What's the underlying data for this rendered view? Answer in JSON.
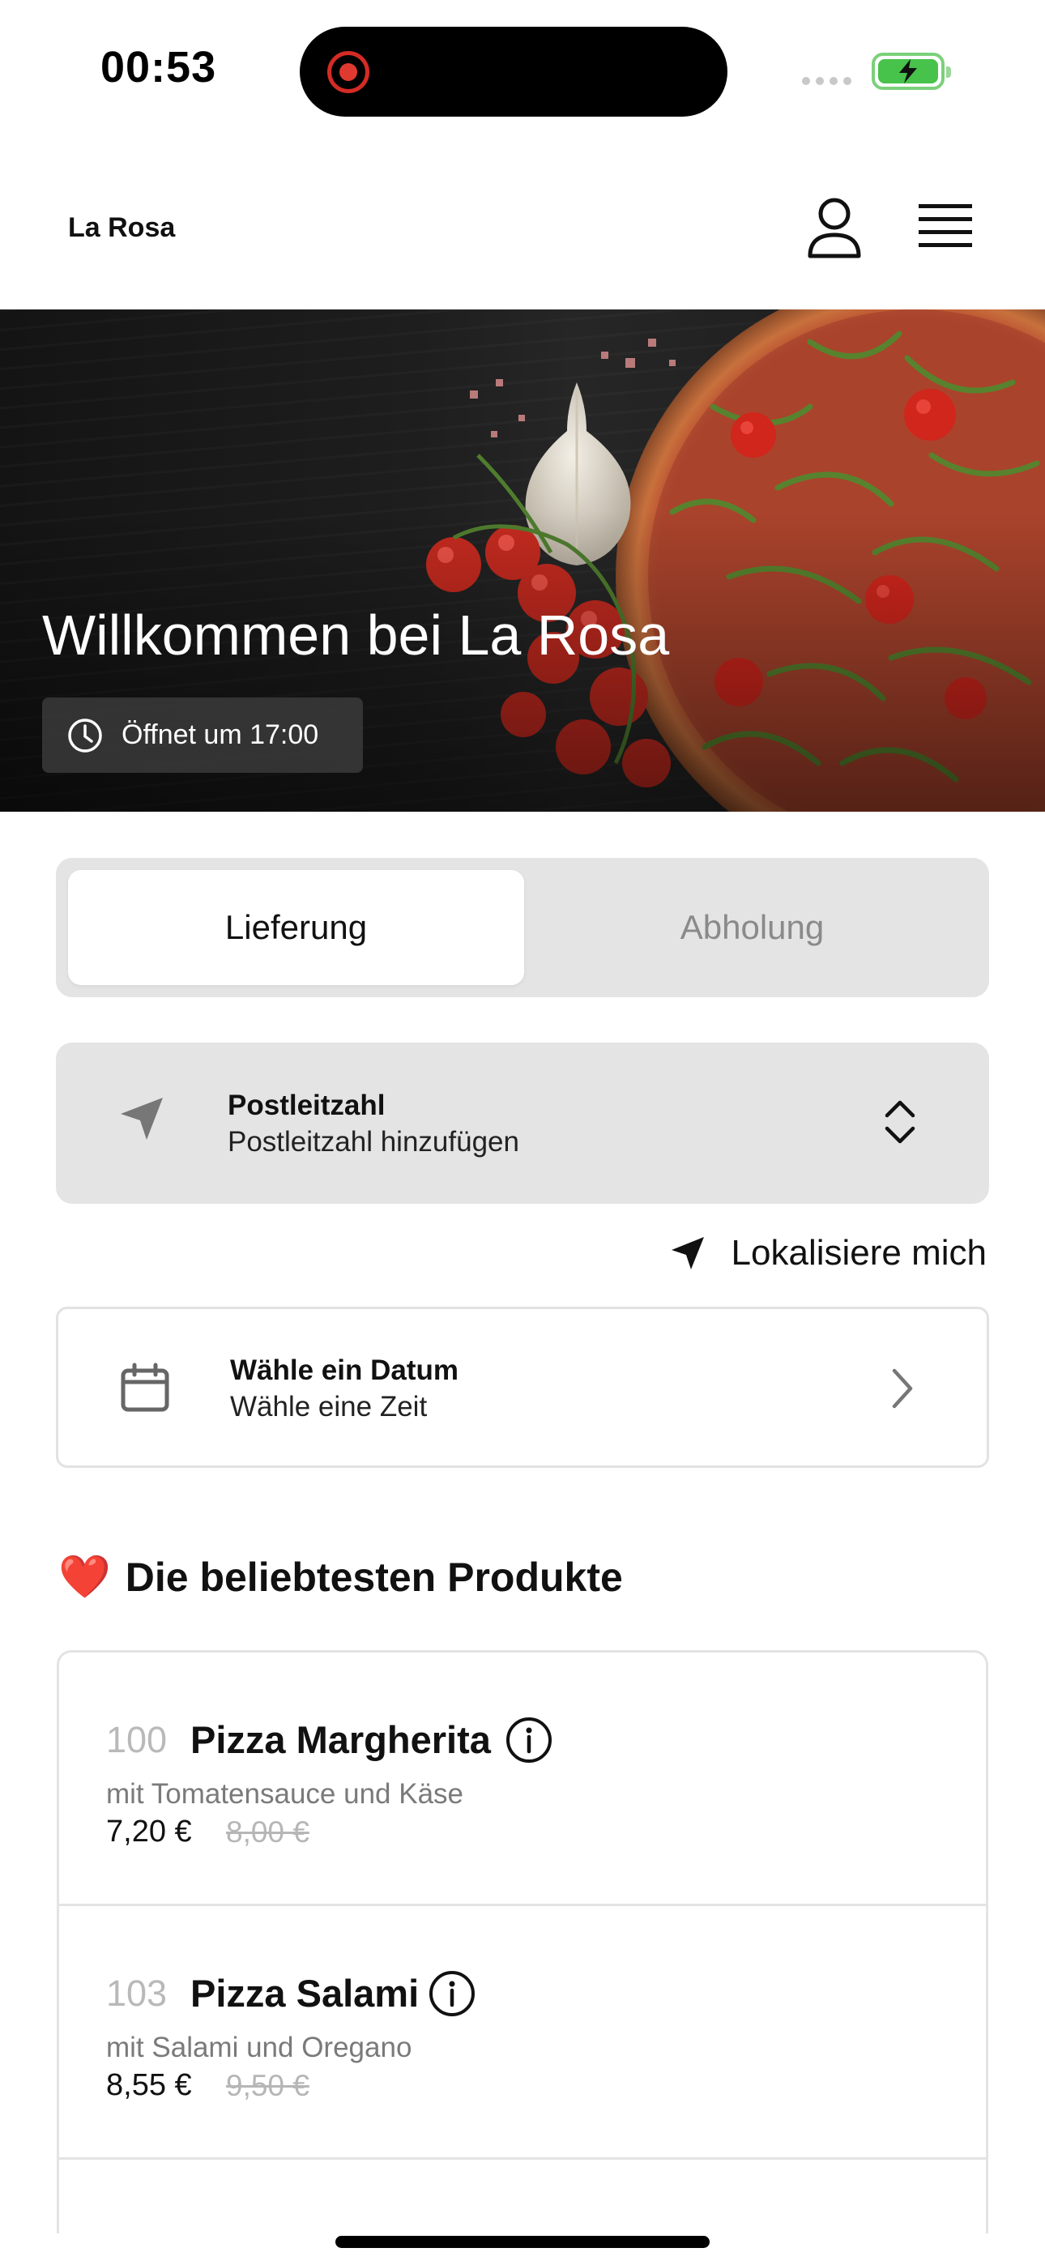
{
  "status_bar": {
    "time": "00:53"
  },
  "header": {
    "brand": "La Rosa"
  },
  "hero": {
    "title": "Willkommen bei La Rosa",
    "opening_badge": "Öffnet um 17:00"
  },
  "order_mode": {
    "options": [
      "Lieferung",
      "Abholung"
    ],
    "selected": "Lieferung"
  },
  "postcode": {
    "label": "Postleitzahl",
    "value": "Postleitzahl hinzufügen"
  },
  "locate": {
    "label": "Lokalisiere mich"
  },
  "schedule": {
    "date_label": "Wähle ein Datum",
    "time_label": "Wähle eine Zeit"
  },
  "popular": {
    "emoji": "❤️",
    "title": "Die beliebtesten Produkte",
    "products": [
      {
        "number": "100",
        "name": "Pizza Margherita",
        "description": "mit Tomatensauce und Käse",
        "price": "7,20 €",
        "old_price": "8,00 €"
      },
      {
        "number": "103",
        "name": "Pizza Salami",
        "description": "mit Salami und Oregano",
        "price": "8,55 €",
        "old_price": "9,50 €"
      }
    ]
  },
  "colors": {
    "accent_record": "#e03a30",
    "battery": "#47c24a",
    "segment_background": "#e4e4e4",
    "heart": "#e0242b"
  },
  "icons": [
    "user-icon",
    "menu-icon",
    "clock-icon",
    "location-arrow-icon",
    "chevron-up-down-icon",
    "calendar-icon",
    "chevron-right-icon",
    "info-icon",
    "heart-icon"
  ]
}
